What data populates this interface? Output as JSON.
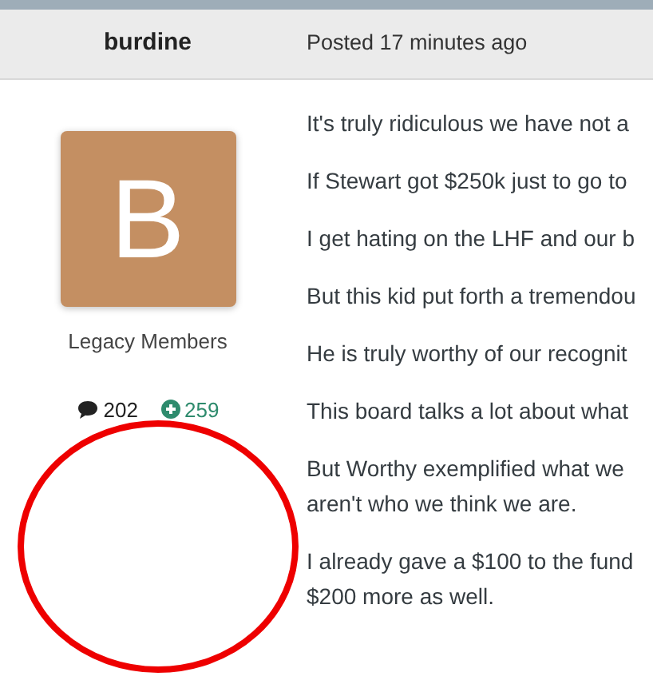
{
  "post": {
    "author": "burdine",
    "posted": "Posted 17 minutes ago",
    "avatar_letter": "B",
    "group": "Legacy Members",
    "posts_count": "202",
    "reputation": "259",
    "paragraphs": [
      {
        "lines": [
          "It's truly ridiculous we have not a"
        ]
      },
      {
        "lines": [
          "If Stewart got $250k just to go to"
        ]
      },
      {
        "lines": [
          "I get hating on the LHF and our b"
        ]
      },
      {
        "lines": [
          "But this kid put forth a tremendou"
        ]
      },
      {
        "lines": [
          "He is truly worthy of our recognit"
        ]
      },
      {
        "lines": [
          "This board talks a lot about what"
        ]
      },
      {
        "lines": [
          "But Worthy exemplified what we",
          "aren't who we think we are."
        ]
      },
      {
        "lines": [
          "I already gave a $100 to the fund",
          "$200 more as well."
        ]
      }
    ]
  }
}
